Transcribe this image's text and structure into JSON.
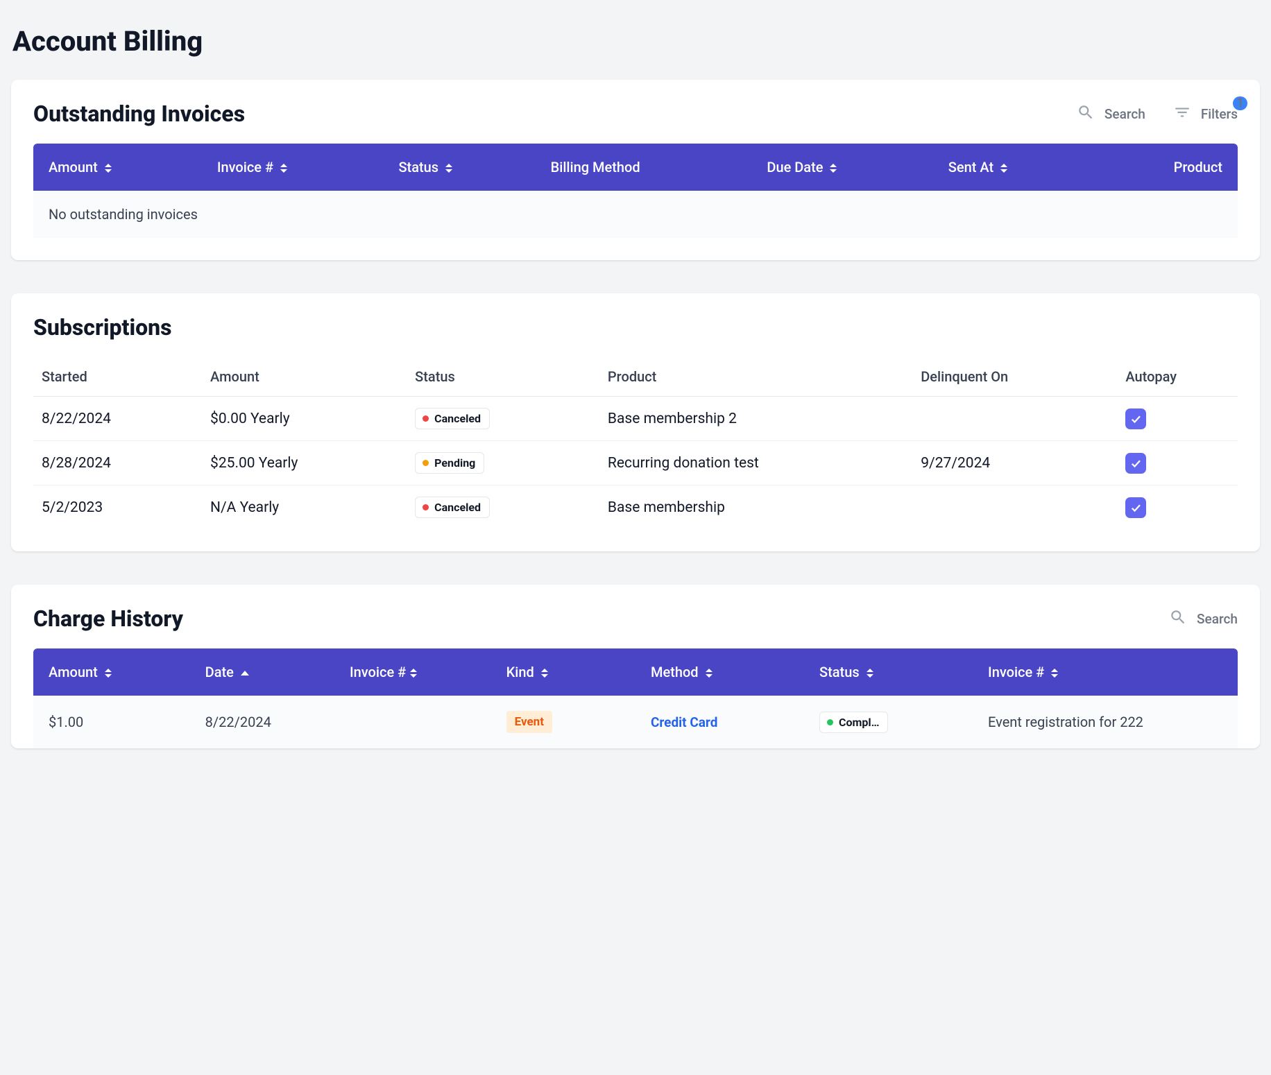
{
  "page": {
    "title": "Account Billing"
  },
  "invoices": {
    "title": "Outstanding Invoices",
    "searchLabel": "Search",
    "filtersLabel": "Filters",
    "filtersCount": "1",
    "columns": {
      "amount": "Amount",
      "invoiceNum": "Invoice #",
      "status": "Status",
      "billingMethod": "Billing Method",
      "dueDate": "Due Date",
      "sentAt": "Sent At",
      "product": "Product"
    },
    "empty": "No outstanding invoices"
  },
  "subscriptions": {
    "title": "Subscriptions",
    "columns": {
      "started": "Started",
      "amount": "Amount",
      "status": "Status",
      "product": "Product",
      "delinquent": "Delinquent On",
      "autopay": "Autopay"
    },
    "rows": [
      {
        "started": "8/22/2024",
        "amount": "$0.00 Yearly",
        "status": "Canceled",
        "statusColor": "red",
        "product": "Base membership 2",
        "delinquent": "",
        "autopay": true
      },
      {
        "started": "8/28/2024",
        "amount": "$25.00 Yearly",
        "status": "Pending",
        "statusColor": "orange",
        "product": "Recurring donation test",
        "delinquent": "9/27/2024",
        "autopay": true
      },
      {
        "started": "5/2/2023",
        "amount": "N/A Yearly",
        "status": "Canceled",
        "statusColor": "red",
        "product": "Base membership",
        "delinquent": "",
        "autopay": true
      }
    ]
  },
  "charges": {
    "title": "Charge History",
    "searchLabel": "Search",
    "columns": {
      "amount": "Amount",
      "date": "Date",
      "invoiceNum": "Invoice #",
      "kind": "Kind",
      "method": "Method",
      "status": "Status",
      "invoiceNum2": "Invoice #"
    },
    "rows": [
      {
        "amount": "$1.00",
        "date": "8/22/2024",
        "invoiceNum": "",
        "kind": "Event",
        "method": "Credit Card",
        "status": "Compl…",
        "statusColor": "green",
        "description": "Event registration for 222"
      }
    ]
  }
}
